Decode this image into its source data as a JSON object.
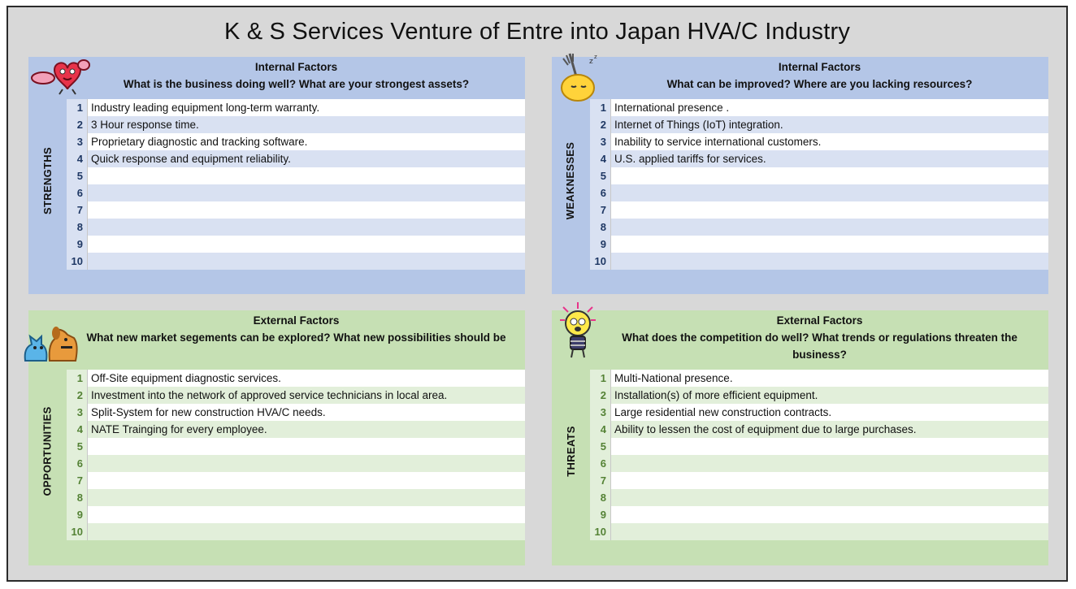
{
  "title": "K & S Services Venture of Entre into Japan HVA/C Industry",
  "strengths": {
    "side_label": "STRENGTHS",
    "factor": "Internal Factors",
    "question": "What is the business doing well? What are your strongest assets?",
    "sticker_icon": "heart-character-icon",
    "rows": [
      {
        "n": "1",
        "text": "Industry leading equipment long-term warranty."
      },
      {
        "n": "2",
        "text": "3 Hour response time."
      },
      {
        "n": "3",
        "text": "Proprietary diagnostic and tracking software."
      },
      {
        "n": "4",
        "text": "Quick response and equipment reliability."
      },
      {
        "n": "5",
        "text": ""
      },
      {
        "n": "6",
        "text": ""
      },
      {
        "n": "7",
        "text": ""
      },
      {
        "n": "8",
        "text": ""
      },
      {
        "n": "9",
        "text": ""
      },
      {
        "n": "10",
        "text": ""
      }
    ]
  },
  "weaknesses": {
    "side_label": "WEAKNESSES",
    "factor": "Internal Factors",
    "question": "What can be improved? Where are you lacking resources?",
    "sticker_icon": "sleepy-lemon-fork-icon",
    "rows": [
      {
        "n": "1",
        "text": "International presence ."
      },
      {
        "n": "2",
        "text": "Internet of Things (IoT) integration."
      },
      {
        "n": "3",
        "text": "Inability to service international customers."
      },
      {
        "n": "4",
        "text": "U.S. applied tariffs for services."
      },
      {
        "n": "5",
        "text": ""
      },
      {
        "n": "6",
        "text": ""
      },
      {
        "n": "7",
        "text": ""
      },
      {
        "n": "8",
        "text": ""
      },
      {
        "n": "9",
        "text": ""
      },
      {
        "n": "10",
        "text": ""
      }
    ]
  },
  "opportunities": {
    "side_label": "OPPORTUNITIES",
    "factor": "External Factors",
    "question": "What new market segements can be explored? What new possibilities should be",
    "sticker_icon": "cat-and-dog-icon",
    "rows": [
      {
        "n": "1",
        "text": "Off-Site equipment diagnostic services."
      },
      {
        "n": "2",
        "text": "Investment into the network of approved service technicians in local area."
      },
      {
        "n": "3",
        "text": "Split-System for new construction HVA/C needs."
      },
      {
        "n": "4",
        "text": "NATE Trainging for every employee."
      },
      {
        "n": "5",
        "text": ""
      },
      {
        "n": "6",
        "text": ""
      },
      {
        "n": "7",
        "text": ""
      },
      {
        "n": "8",
        "text": ""
      },
      {
        "n": "9",
        "text": ""
      },
      {
        "n": "10",
        "text": ""
      }
    ]
  },
  "threats": {
    "side_label": "THREATS",
    "factor": "External Factors",
    "question_line1": "What does the competition do well? What trends or regulations threaten the",
    "question_line2": "business?",
    "sticker_icon": "scared-lightbulb-icon",
    "rows": [
      {
        "n": "1",
        "text": "Multi-National presence."
      },
      {
        "n": "2",
        "text": "Installation(s) of more efficient equipment."
      },
      {
        "n": "3",
        "text": "Large residential new construction contracts."
      },
      {
        "n": "4",
        "text": "Ability to lessen the cost of equipment due to large purchases."
      },
      {
        "n": "5",
        "text": ""
      },
      {
        "n": "6",
        "text": ""
      },
      {
        "n": "7",
        "text": ""
      },
      {
        "n": "8",
        "text": ""
      },
      {
        "n": "9",
        "text": ""
      },
      {
        "n": "10",
        "text": ""
      }
    ]
  }
}
